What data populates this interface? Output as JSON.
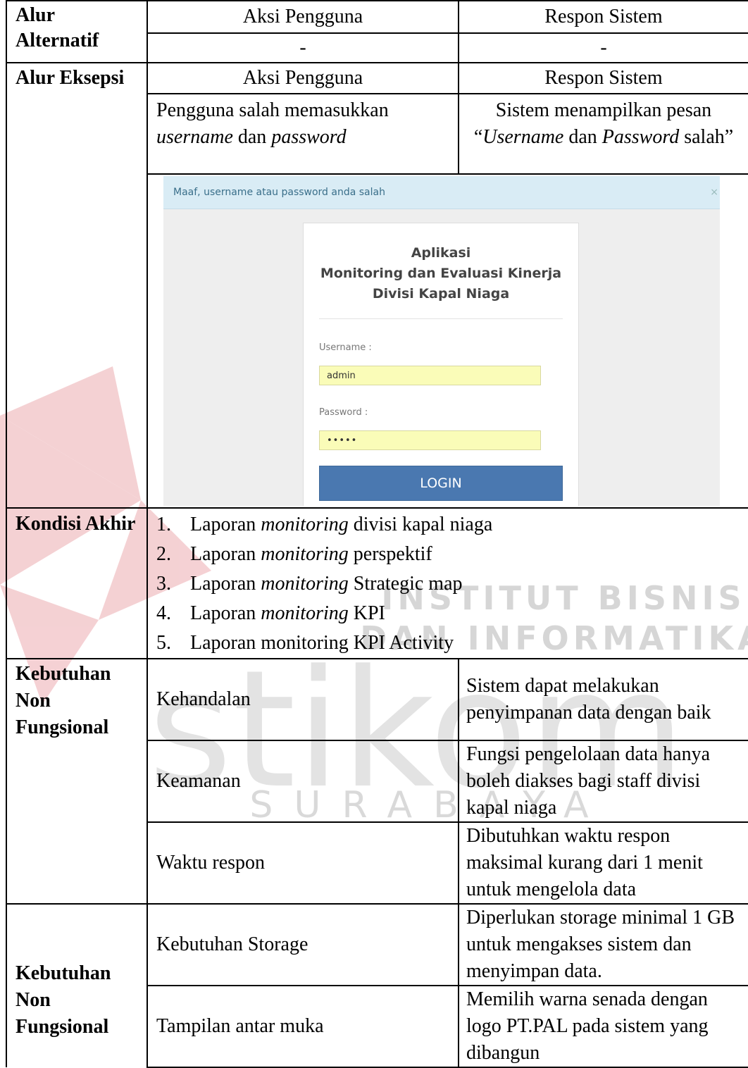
{
  "alt_flow": {
    "label": "Alur Alternatif",
    "col_user": "Aksi Pengguna",
    "col_system": "Respon Sistem",
    "user_value": "-",
    "system_value": "-"
  },
  "exception_flow": {
    "label": "Alur Eksepsi",
    "col_user": "Aksi Pengguna",
    "col_system": "Respon Sistem",
    "user_action_pre": "Pengguna salah memasukkan ",
    "user_action_em1": "username",
    "user_action_mid": " dan ",
    "user_action_em2": "password",
    "system_pre": "Sistem menampilkan pesan “",
    "system_em1": "Username",
    "system_mid": " dan ",
    "system_em2": "Password",
    "system_post": " salah”"
  },
  "login_screen": {
    "alert_text": "Maaf, username atau password anda salah",
    "close_glyph": "×",
    "title_line1": "Aplikasi",
    "title_line2": "Monitoring dan Evaluasi Kinerja",
    "title_line3": "Divisi Kapal Niaga",
    "username_label": "Username :",
    "username_value": "admin",
    "password_label": "Password :",
    "password_value": "•••••",
    "login_button": "LOGIN"
  },
  "final_condition": {
    "label": "Kondisi Akhir",
    "items": [
      {
        "num": "1.",
        "pre": "Laporan ",
        "em": "monitoring",
        "post": " divisi kapal niaga"
      },
      {
        "num": "2.",
        "pre": "Laporan ",
        "em": "monitoring",
        "post": " perspektif"
      },
      {
        "num": "3.",
        "pre": "Laporan ",
        "em": "monitoring",
        "post": " Strategic map"
      },
      {
        "num": "4.",
        "pre": "Laporan ",
        "em": "monitoring",
        "post": " KPI"
      },
      {
        "num": "5.",
        "pre": "Laporan monitoring KPI Activity",
        "em": "",
        "post": ""
      }
    ]
  },
  "non_functional": {
    "label": "Kebutuhan Non Fungsional",
    "rows": [
      {
        "name": "Kehandalan",
        "desc": "Sistem dapat melakukan penyimpanan data dengan baik"
      },
      {
        "name": "Keamanan",
        "desc": "Fungsi pengelolaan data hanya boleh diakses bagi staff divisi kapal niaga"
      },
      {
        "name": "Waktu respon",
        "desc": "Dibutuhkan waktu respon maksimal kurang dari 1 menit untuk mengelola data"
      },
      {
        "name": "Kebutuhan Storage",
        "desc": "Diperlukan storage minimal 1 GB untuk mengakses sistem dan menyimpan data."
      },
      {
        "name": "Tampilan antar muka",
        "desc": "Memilih warna senada dengan logo PT.PAL pada sistem yang dibangun"
      }
    ]
  },
  "watermark": {
    "line1": "INSTITUT BISNIS",
    "line2": "DAN INFORMATIKA",
    "word": "stikom",
    "city": "SURABAYA",
    "logo_color": "#e8a0a6"
  }
}
